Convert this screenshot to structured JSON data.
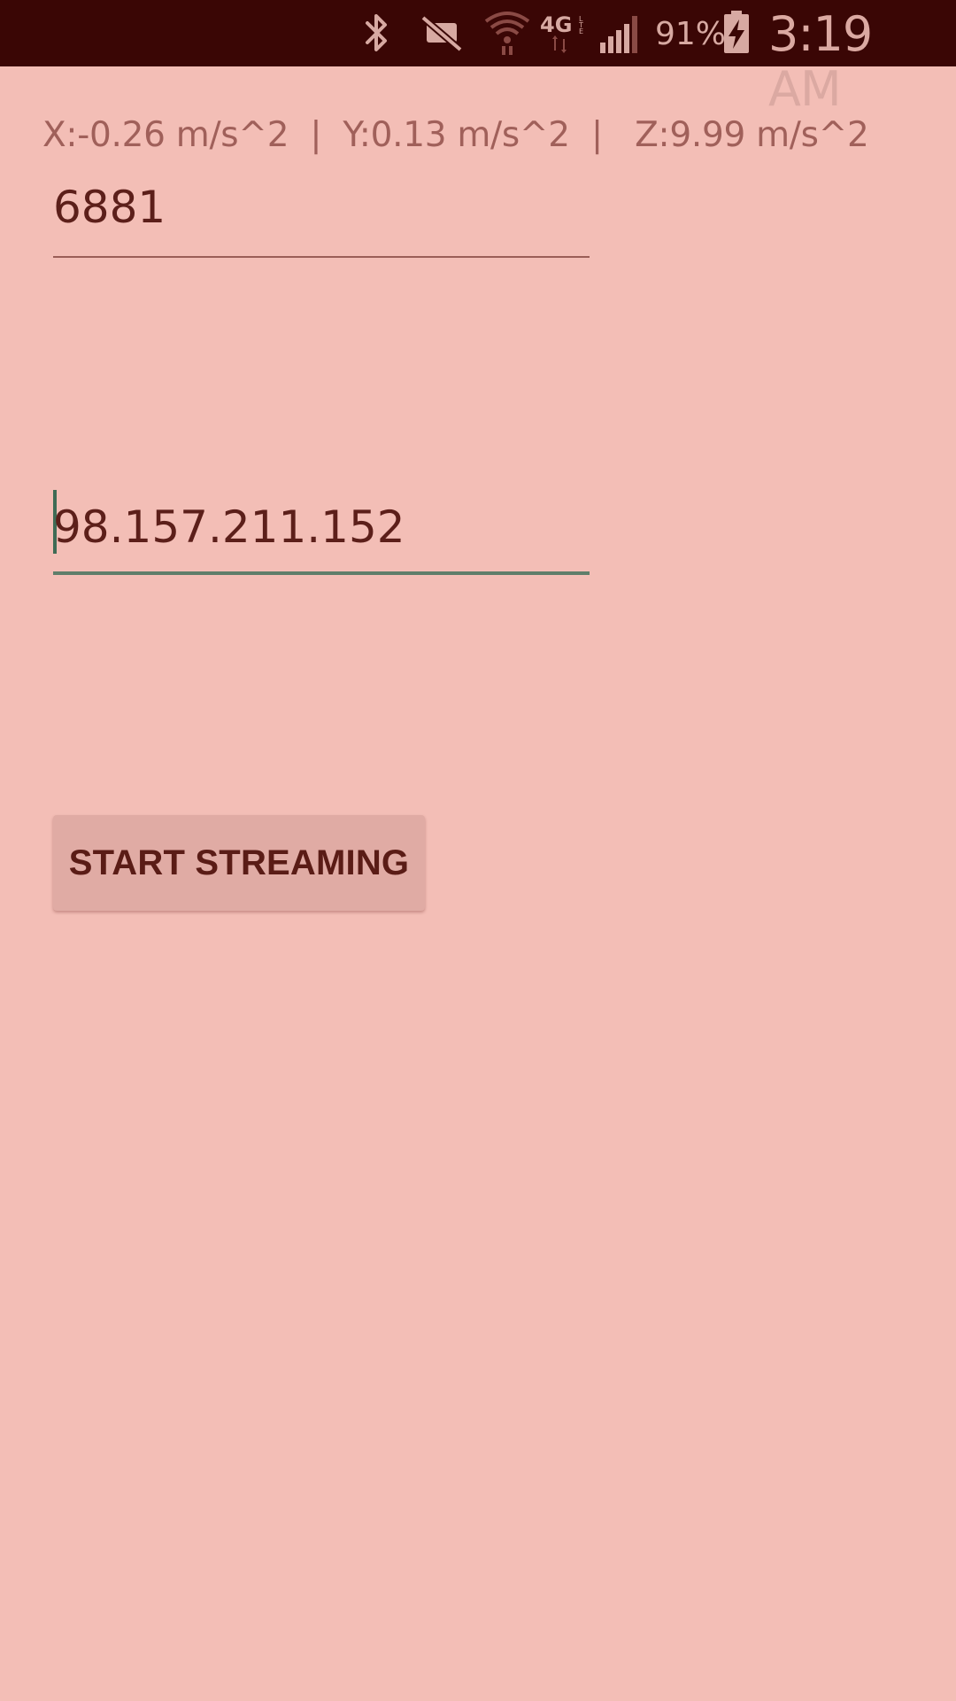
{
  "status_bar": {
    "icons": [
      "bluetooth-icon",
      "vibrate-off-icon",
      "wifi-icon",
      "4g-lte-icon",
      "cell-signal-icon",
      "battery-charging-icon"
    ],
    "battery_percent": "91%",
    "time": "3:19 AM",
    "colors": {
      "background": "#3a0605",
      "foreground": "#d7a9a2"
    }
  },
  "main": {
    "accelerometer_readout": "X:-0.26 m/s^2  |  Y:0.13 m/s^2  |   Z:9.99 m/s^2",
    "port_field": {
      "value": "6881"
    },
    "ip_field": {
      "value": "98.157.211.152",
      "focused": true
    },
    "start_button": {
      "label": "START STREAMING"
    }
  },
  "colors": {
    "background": "#f3beb6",
    "text": "#5c1f1a",
    "muted_text": "#a0605a",
    "accent": "#5f7e6a",
    "button": "#e0aba4"
  }
}
